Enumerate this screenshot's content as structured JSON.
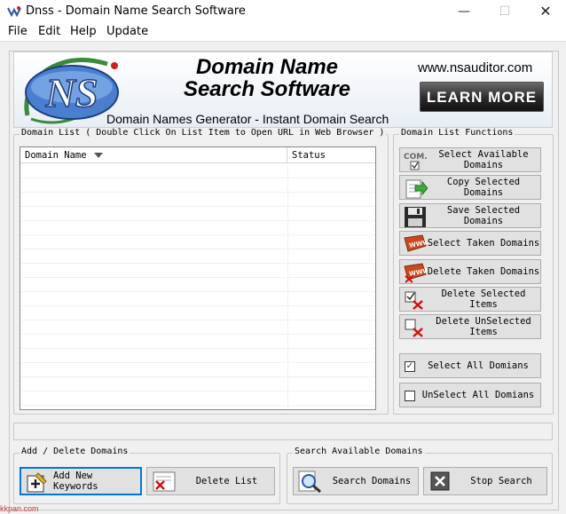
{
  "window": {
    "title": "Dnss - Domain Name Search Software",
    "minimize": "—",
    "maximize": "☐",
    "close": "✕"
  },
  "menu": [
    "File",
    "Edit",
    "Help",
    "Update"
  ],
  "banner": {
    "logo_text": "NS",
    "title_line1": "Domain Name",
    "title_line2": "Search Software",
    "subtitle": "Domain Names Generator - Instant Domain Search",
    "url": "www.nsauditor.com",
    "learn_more": "LEARN MORE"
  },
  "domain_list": {
    "group_label": "Domain List ( Double Click On List Item to Open URL in Web Browser )",
    "columns": [
      "Domain Name",
      "Status"
    ],
    "rows": []
  },
  "functions": {
    "group_label": "Domain List Functions",
    "buttons": [
      {
        "label": "Select Available Domains",
        "icon": "com-checkbox-icon"
      },
      {
        "label": "Copy Selected Domains",
        "icon": "copy-document-icon"
      },
      {
        "label": "Save Selected Domains",
        "icon": "floppy-disk-icon"
      },
      {
        "label": "Select Taken Domains",
        "icon": "www-tag-icon"
      },
      {
        "label": "Delete Taken Domains",
        "icon": "www-delete-icon"
      },
      {
        "label": "Delete Selected Items",
        "icon": "checked-delete-icon"
      },
      {
        "label": "Delete UnSelected Items",
        "icon": "unchecked-delete-icon"
      },
      {
        "label": "Select All Domians",
        "checkbox": "✓"
      },
      {
        "label": "UnSelect All Domians",
        "checkbox": ""
      }
    ]
  },
  "add_delete": {
    "group_label": "Add / Delete Domains",
    "add_keywords": "Add New Keywords",
    "delete_list": "Delete List"
  },
  "search": {
    "group_label": "Search Available Domains",
    "search_domains": "Search Domains",
    "stop_search": "Stop Search"
  },
  "watermark": "kkpan.com",
  "colors": {
    "accent": "#0078d7",
    "face": "#f0f0f0",
    "button": "#e1e1e1",
    "learn_more_bg": "#2a2a2a",
    "logo_green": "#3a8a3a",
    "logo_blue": "#2a55a8"
  }
}
